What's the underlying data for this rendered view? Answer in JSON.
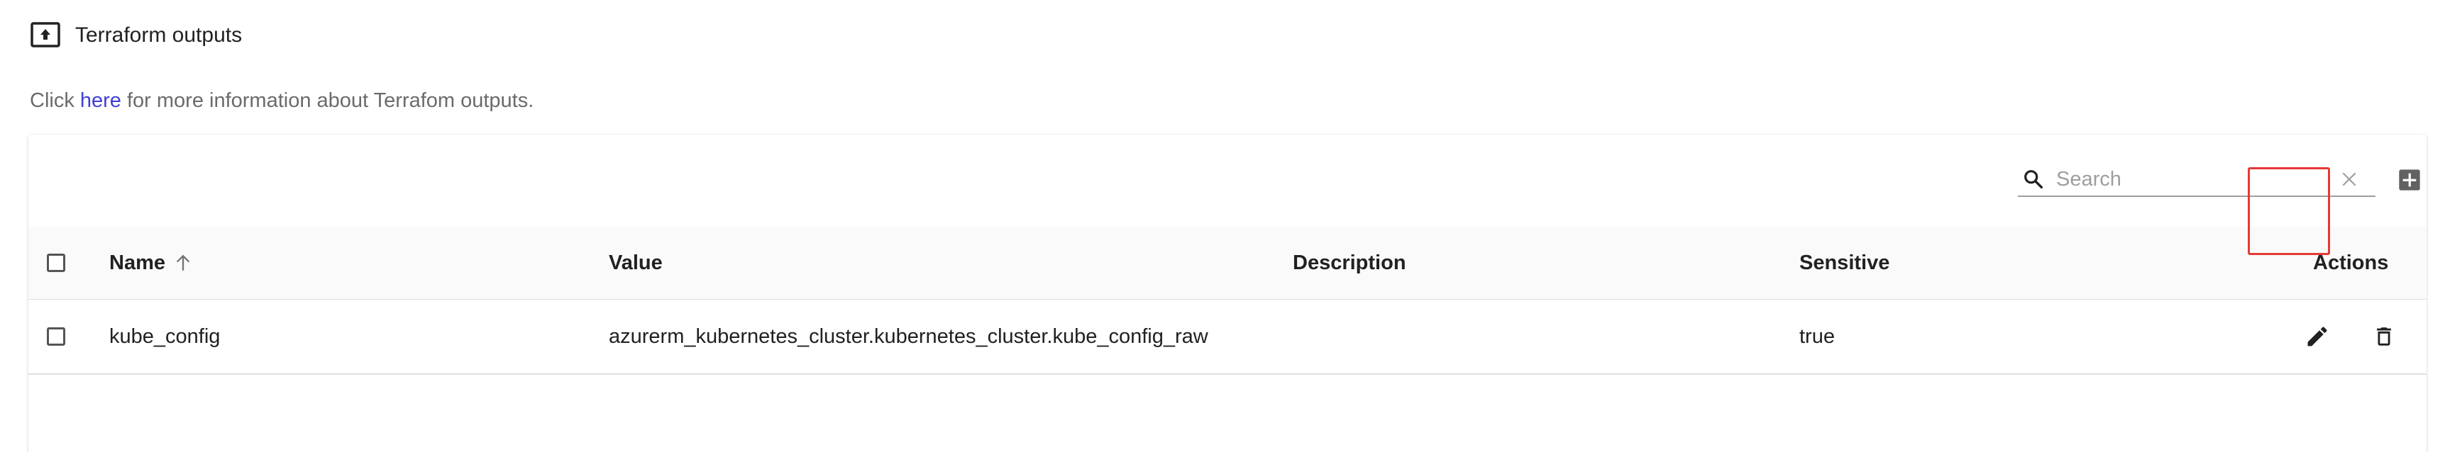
{
  "header": {
    "title": "Terraform outputs",
    "title_icon": "upload-box-icon"
  },
  "info": {
    "prefix": "Click ",
    "link_text": "here",
    "suffix": " for more information about Terrafom outputs."
  },
  "toolbar": {
    "search_placeholder": "Search",
    "search_value": "",
    "search_icon": "search-icon",
    "clear_icon": "close-icon",
    "add_icon": "add-box-icon"
  },
  "table": {
    "columns": {
      "name": "Name",
      "value": "Value",
      "description": "Description",
      "sensitive": "Sensitive",
      "actions": "Actions"
    },
    "sort": {
      "column": "name",
      "direction": "ascending"
    },
    "rows": [
      {
        "name": "kube_config",
        "value": "azurerm_kubernetes_cluster.kubernetes_cluster.kube_config_raw",
        "description": "",
        "sensitive": "true",
        "actions": [
          "edit-icon",
          "delete-icon"
        ]
      }
    ]
  },
  "colors": {
    "link": "#3f3fd6",
    "highlight": "#e53935",
    "header_bg": "#fafafa"
  }
}
